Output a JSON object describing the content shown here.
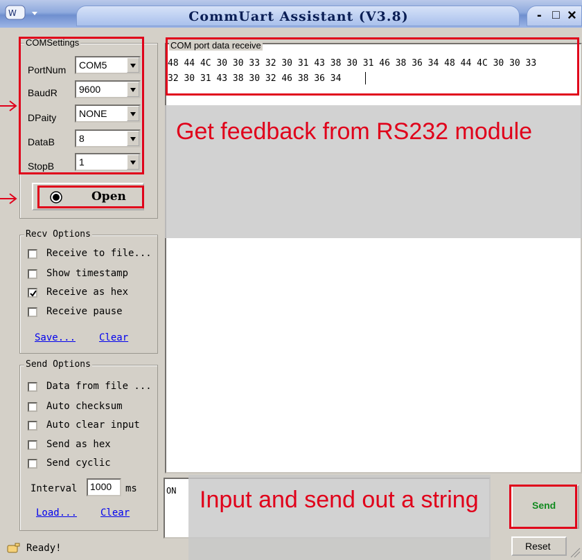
{
  "window": {
    "title": "CommUart Assistant (V3.8)",
    "controls": {
      "minimize": "-",
      "maximize": "□",
      "close": "×"
    }
  },
  "com_settings": {
    "title": "COMSettings",
    "port_label": "PortNum",
    "port_value": "COM5",
    "baud_label": "BaudR",
    "baud_value": "9600",
    "parity_label": "DPaity",
    "parity_value": "NONE",
    "databits_label": "DataB",
    "databits_value": "8",
    "stopbits_label": "StopB",
    "stopbits_value": "1",
    "open_button": "Open"
  },
  "recv_options": {
    "title": "Recv Options",
    "items": [
      {
        "label": "Receive to file...",
        "checked": false
      },
      {
        "label": "Show timestamp",
        "checked": false
      },
      {
        "label": "Receive as hex",
        "checked": true
      },
      {
        "label": "Receive pause",
        "checked": false
      }
    ],
    "save_link": "Save...",
    "clear_link": "Clear"
  },
  "send_options": {
    "title": "Send Options",
    "items": [
      {
        "label": "Data from file ...",
        "checked": false
      },
      {
        "label": "Auto checksum",
        "checked": false
      },
      {
        "label": "Auto clear input",
        "checked": false
      },
      {
        "label": "Send as hex",
        "checked": false
      },
      {
        "label": "Send cyclic",
        "checked": false
      }
    ],
    "interval_label": "Interval",
    "interval_value": "1000",
    "interval_unit": "ms",
    "load_link": "Load...",
    "clear_link": "Clear"
  },
  "receive_area": {
    "title": "COM port data receive",
    "line1": "48 44 4C 30 30 33 32 30 31 43 38 30 31 46 38 36 34 48 44 4C 30 30 33",
    "line2": "32 30 31 43 38 30 32 46 38 36 34"
  },
  "send_area": {
    "input_value": "ON",
    "send_button": "Send",
    "reset_button": "Reset"
  },
  "status": {
    "text": "Ready!"
  },
  "annotations": {
    "receive_caption": "Get feedback from RS232 module",
    "send_caption": "Input and send out a string",
    "highlight_color": "#e0001a"
  }
}
